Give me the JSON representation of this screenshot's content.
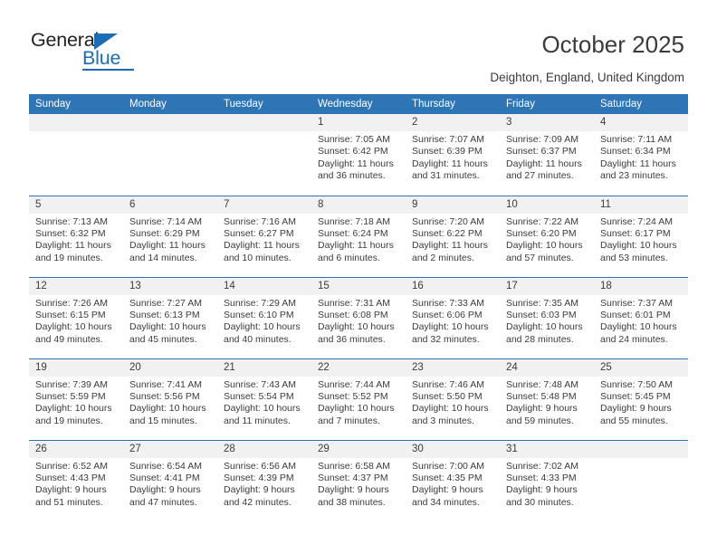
{
  "brand": {
    "name_top": "General",
    "name_bottom": "Blue",
    "accent_color": "#1c6cb5"
  },
  "header": {
    "title": "October 2025",
    "subtitle": "Deighton, England, United Kingdom"
  },
  "theme": {
    "header_bar_color": "#2e75b6",
    "day_strip_color": "#f1f1f1",
    "text_color": "#3b3b3b"
  },
  "weekdays": [
    "Sunday",
    "Monday",
    "Tuesday",
    "Wednesday",
    "Thursday",
    "Friday",
    "Saturday"
  ],
  "weeks": [
    [
      {
        "day": "",
        "lines": []
      },
      {
        "day": "",
        "lines": []
      },
      {
        "day": "",
        "lines": []
      },
      {
        "day": "1",
        "lines": [
          "Sunrise: 7:05 AM",
          "Sunset: 6:42 PM",
          "Daylight: 11 hours",
          "and 36 minutes."
        ]
      },
      {
        "day": "2",
        "lines": [
          "Sunrise: 7:07 AM",
          "Sunset: 6:39 PM",
          "Daylight: 11 hours",
          "and 31 minutes."
        ]
      },
      {
        "day": "3",
        "lines": [
          "Sunrise: 7:09 AM",
          "Sunset: 6:37 PM",
          "Daylight: 11 hours",
          "and 27 minutes."
        ]
      },
      {
        "day": "4",
        "lines": [
          "Sunrise: 7:11 AM",
          "Sunset: 6:34 PM",
          "Daylight: 11 hours",
          "and 23 minutes."
        ]
      }
    ],
    [
      {
        "day": "5",
        "lines": [
          "Sunrise: 7:13 AM",
          "Sunset: 6:32 PM",
          "Daylight: 11 hours",
          "and 19 minutes."
        ]
      },
      {
        "day": "6",
        "lines": [
          "Sunrise: 7:14 AM",
          "Sunset: 6:29 PM",
          "Daylight: 11 hours",
          "and 14 minutes."
        ]
      },
      {
        "day": "7",
        "lines": [
          "Sunrise: 7:16 AM",
          "Sunset: 6:27 PM",
          "Daylight: 11 hours",
          "and 10 minutes."
        ]
      },
      {
        "day": "8",
        "lines": [
          "Sunrise: 7:18 AM",
          "Sunset: 6:24 PM",
          "Daylight: 11 hours",
          "and 6 minutes."
        ]
      },
      {
        "day": "9",
        "lines": [
          "Sunrise: 7:20 AM",
          "Sunset: 6:22 PM",
          "Daylight: 11 hours",
          "and 2 minutes."
        ]
      },
      {
        "day": "10",
        "lines": [
          "Sunrise: 7:22 AM",
          "Sunset: 6:20 PM",
          "Daylight: 10 hours",
          "and 57 minutes."
        ]
      },
      {
        "day": "11",
        "lines": [
          "Sunrise: 7:24 AM",
          "Sunset: 6:17 PM",
          "Daylight: 10 hours",
          "and 53 minutes."
        ]
      }
    ],
    [
      {
        "day": "12",
        "lines": [
          "Sunrise: 7:26 AM",
          "Sunset: 6:15 PM",
          "Daylight: 10 hours",
          "and 49 minutes."
        ]
      },
      {
        "day": "13",
        "lines": [
          "Sunrise: 7:27 AM",
          "Sunset: 6:13 PM",
          "Daylight: 10 hours",
          "and 45 minutes."
        ]
      },
      {
        "day": "14",
        "lines": [
          "Sunrise: 7:29 AM",
          "Sunset: 6:10 PM",
          "Daylight: 10 hours",
          "and 40 minutes."
        ]
      },
      {
        "day": "15",
        "lines": [
          "Sunrise: 7:31 AM",
          "Sunset: 6:08 PM",
          "Daylight: 10 hours",
          "and 36 minutes."
        ]
      },
      {
        "day": "16",
        "lines": [
          "Sunrise: 7:33 AM",
          "Sunset: 6:06 PM",
          "Daylight: 10 hours",
          "and 32 minutes."
        ]
      },
      {
        "day": "17",
        "lines": [
          "Sunrise: 7:35 AM",
          "Sunset: 6:03 PM",
          "Daylight: 10 hours",
          "and 28 minutes."
        ]
      },
      {
        "day": "18",
        "lines": [
          "Sunrise: 7:37 AM",
          "Sunset: 6:01 PM",
          "Daylight: 10 hours",
          "and 24 minutes."
        ]
      }
    ],
    [
      {
        "day": "19",
        "lines": [
          "Sunrise: 7:39 AM",
          "Sunset: 5:59 PM",
          "Daylight: 10 hours",
          "and 19 minutes."
        ]
      },
      {
        "day": "20",
        "lines": [
          "Sunrise: 7:41 AM",
          "Sunset: 5:56 PM",
          "Daylight: 10 hours",
          "and 15 minutes."
        ]
      },
      {
        "day": "21",
        "lines": [
          "Sunrise: 7:43 AM",
          "Sunset: 5:54 PM",
          "Daylight: 10 hours",
          "and 11 minutes."
        ]
      },
      {
        "day": "22",
        "lines": [
          "Sunrise: 7:44 AM",
          "Sunset: 5:52 PM",
          "Daylight: 10 hours",
          "and 7 minutes."
        ]
      },
      {
        "day": "23",
        "lines": [
          "Sunrise: 7:46 AM",
          "Sunset: 5:50 PM",
          "Daylight: 10 hours",
          "and 3 minutes."
        ]
      },
      {
        "day": "24",
        "lines": [
          "Sunrise: 7:48 AM",
          "Sunset: 5:48 PM",
          "Daylight: 9 hours",
          "and 59 minutes."
        ]
      },
      {
        "day": "25",
        "lines": [
          "Sunrise: 7:50 AM",
          "Sunset: 5:45 PM",
          "Daylight: 9 hours",
          "and 55 minutes."
        ]
      }
    ],
    [
      {
        "day": "26",
        "lines": [
          "Sunrise: 6:52 AM",
          "Sunset: 4:43 PM",
          "Daylight: 9 hours",
          "and 51 minutes."
        ]
      },
      {
        "day": "27",
        "lines": [
          "Sunrise: 6:54 AM",
          "Sunset: 4:41 PM",
          "Daylight: 9 hours",
          "and 47 minutes."
        ]
      },
      {
        "day": "28",
        "lines": [
          "Sunrise: 6:56 AM",
          "Sunset: 4:39 PM",
          "Daylight: 9 hours",
          "and 42 minutes."
        ]
      },
      {
        "day": "29",
        "lines": [
          "Sunrise: 6:58 AM",
          "Sunset: 4:37 PM",
          "Daylight: 9 hours",
          "and 38 minutes."
        ]
      },
      {
        "day": "30",
        "lines": [
          "Sunrise: 7:00 AM",
          "Sunset: 4:35 PM",
          "Daylight: 9 hours",
          "and 34 minutes."
        ]
      },
      {
        "day": "31",
        "lines": [
          "Sunrise: 7:02 AM",
          "Sunset: 4:33 PM",
          "Daylight: 9 hours",
          "and 30 minutes."
        ]
      },
      {
        "day": "",
        "lines": []
      }
    ]
  ]
}
